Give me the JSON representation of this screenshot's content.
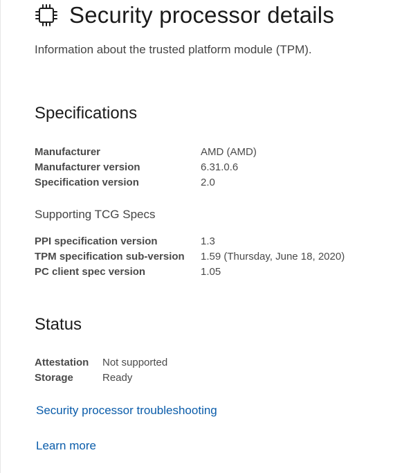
{
  "page": {
    "title": "Security processor details",
    "subtitle": "Information about the trusted platform module (TPM).",
    "icon": "chip-icon"
  },
  "specifications": {
    "heading": "Specifications",
    "rows": [
      {
        "label": "Manufacturer",
        "value": "AMD (AMD)"
      },
      {
        "label": "Manufacturer version",
        "value": "6.31.0.6"
      },
      {
        "label": "Specification version",
        "value": "2.0"
      }
    ]
  },
  "tcg": {
    "heading": "Supporting TCG Specs",
    "rows": [
      {
        "label": "PPI specification version",
        "value": "1.3"
      },
      {
        "label": "TPM specification sub-version",
        "value": "1.59 (Thursday, June 18, 2020)"
      },
      {
        "label": "PC client spec version",
        "value": "1.05"
      }
    ]
  },
  "status": {
    "heading": "Status",
    "rows": [
      {
        "label": "Attestation",
        "value": "Not supported"
      },
      {
        "label": "Storage",
        "value": "Ready"
      }
    ]
  },
  "links": {
    "troubleshooting": "Security processor troubleshooting",
    "learn_more": "Learn more"
  },
  "colors": {
    "link": "#0a5caa",
    "text": "#1b1b1b",
    "muted": "#4a4a4a"
  }
}
